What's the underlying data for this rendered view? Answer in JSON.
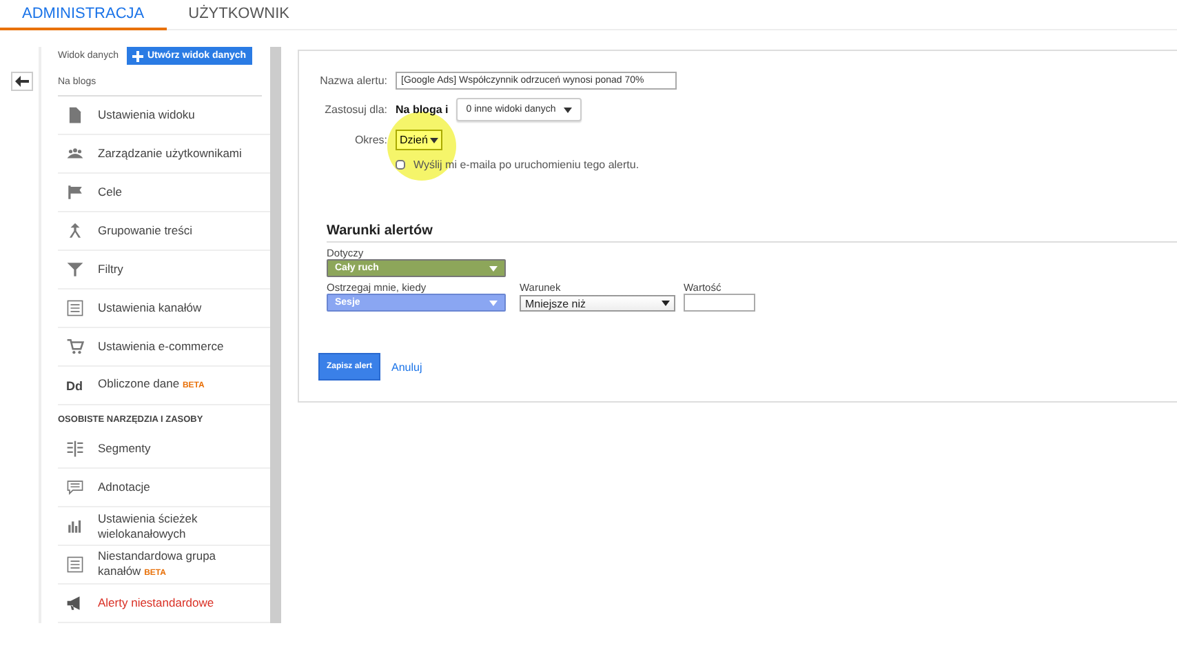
{
  "tabs": [
    {
      "label": "ADMINISTRACJA",
      "selected": true
    },
    {
      "label": "UŻYTKOWNIK",
      "selected": false
    }
  ],
  "sidebar": {
    "view_label": "Widok danych",
    "create_button": "Utwórz widok danych",
    "view_name": "Na blogs",
    "items": [
      {
        "kind": "item",
        "label": "Ustawienia widoku",
        "selected": false
      },
      {
        "kind": "item",
        "label": "Zarządzanie użytkownikami",
        "selected": false
      },
      {
        "kind": "item",
        "label": "Cele",
        "selected": false
      },
      {
        "kind": "item",
        "label": "Grupowanie treści",
        "selected": false
      },
      {
        "kind": "item",
        "label": "Filtry",
        "selected": false
      },
      {
        "kind": "item",
        "label": "Ustawienia kanałów",
        "selected": false
      },
      {
        "kind": "item",
        "label": "Ustawienia e-commerce",
        "selected": false
      },
      {
        "kind": "item",
        "label": "Obliczone dane",
        "icon_text": "Dd",
        "badge": "BETA",
        "selected": false
      },
      {
        "kind": "section",
        "label": "OSOBISTE NARZĘDZIA I ZASOBY"
      },
      {
        "kind": "item",
        "label": "Segmenty",
        "selected": false
      },
      {
        "kind": "item",
        "label": "Adnotacje",
        "selected": false
      },
      {
        "kind": "item",
        "label": "Ustawienia ścieżek wielokanałowych",
        "selected": false
      },
      {
        "kind": "item",
        "label": "Niestandardowa grupa kanałów",
        "badge": "BETA",
        "selected": false
      },
      {
        "kind": "item",
        "label": "Alerty niestandardowe",
        "selected": true
      }
    ]
  },
  "alert_form": {
    "name_label": "Nazwa alertu:",
    "name_value": "[Google Ads] Współczynnik odrzuceń wynosi ponad 70%",
    "apply_label": "Zastosuj dla:",
    "apply_view": "Na bloga i",
    "apply_dropdown": "0 inne widoki danych",
    "period_label": "Okres:",
    "period_value": "Dzień",
    "email_label": "Wyślij mi e-maila po uruchomieniu tego alertu.",
    "email_checked": false,
    "conditions_title": "Warunki alertów",
    "applies_label": "Dotyczy",
    "applies_value": "Cały ruch",
    "when_label": "Ostrzegaj mnie, kiedy",
    "when_value": "Sesje",
    "condition_label": "Warunek",
    "condition_value": "Mniejsze niż",
    "value_label": "Wartość",
    "save_button": "Zapisz alert",
    "cancel_link": "Anuluj"
  }
}
